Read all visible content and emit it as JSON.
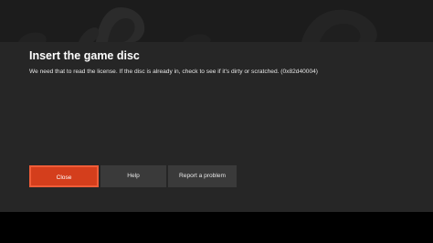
{
  "dialog": {
    "title": "Insert the game disc",
    "message": "We need that to read the license. If the disc is already in, check to see if it's dirty or scratched. (0x82d40004)"
  },
  "buttons": {
    "close_label": "Close",
    "help_label": "Help",
    "report_label": "Report a problem"
  },
  "colors": {
    "accent": "#d43e1c",
    "dialog_background": "#262626",
    "button_background": "#3a3a3a"
  }
}
